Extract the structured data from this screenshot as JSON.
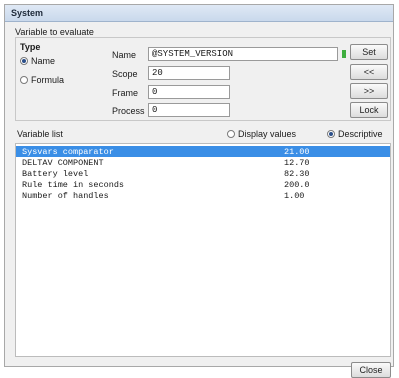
{
  "window": {
    "title": "System"
  },
  "group": {
    "title": "Variable to evaluate",
    "type_label": "Type",
    "radio_name": "Name",
    "radio_formula": "Formula",
    "name_label": "Name",
    "name_value": "@SYSTEM_VERSION",
    "scope_label": "Scope",
    "scope_value": "20",
    "frame_label": "Frame",
    "frame_value": "0",
    "process_label": "Process",
    "process_value": "0",
    "buttons": {
      "btn1": "Set",
      "btn2": "<<",
      "btn3": ">>",
      "btn4": "Lock"
    }
  },
  "list_header": {
    "label": "Variable list",
    "display_values": "Display values",
    "descriptive": "Descriptive"
  },
  "rows": [
    {
      "name": "Sysvars comparator",
      "value": "21.00"
    },
    {
      "name": "DELTAV COMPONENT",
      "value": "12.70"
    },
    {
      "name": "Battery level",
      "value": "82.30"
    },
    {
      "name": "Rule time in seconds",
      "value": "200.0"
    },
    {
      "name": "Number of handles",
      "value": "1.00"
    }
  ],
  "close_label": "Close"
}
